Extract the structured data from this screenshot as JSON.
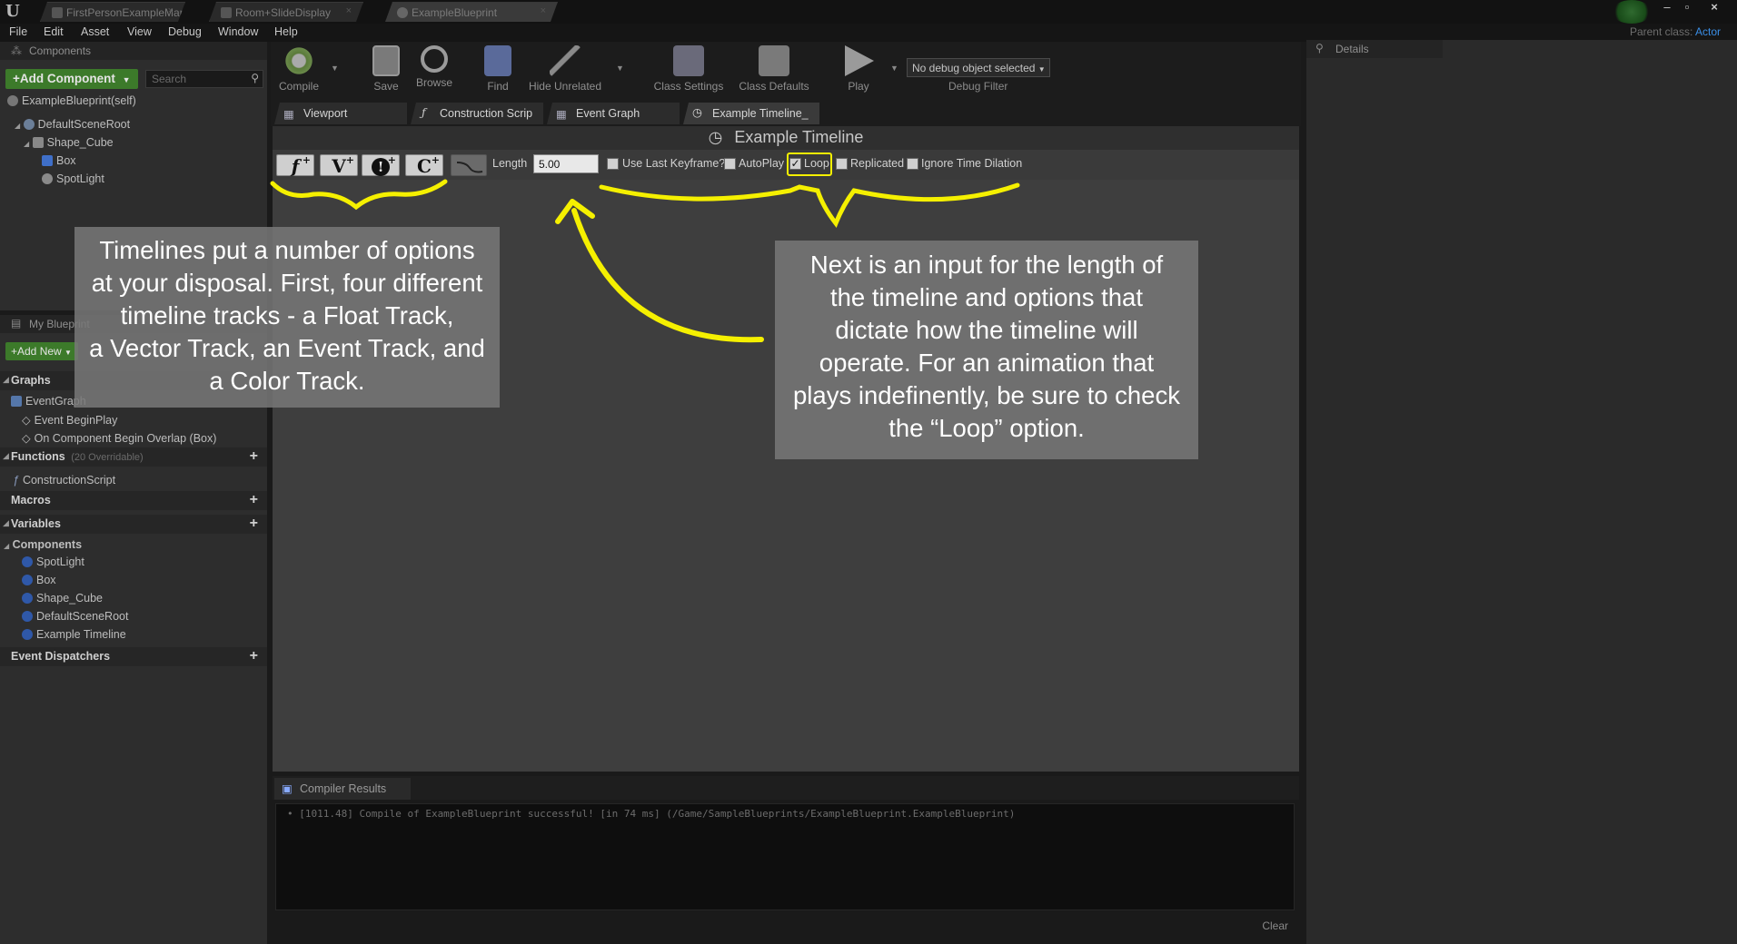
{
  "window": {
    "logo": "U",
    "tabs": [
      "FirstPersonExampleMap",
      "Room+SlideDisplay",
      "ExampleBlueprint"
    ],
    "parent_class_label": "Parent class:",
    "parent_class_value": "Actor"
  },
  "menu": [
    "File",
    "Edit",
    "Asset",
    "View",
    "Debug",
    "Window",
    "Help"
  ],
  "components_panel": {
    "title": "Components",
    "add_button": "+Add Component",
    "search_placeholder": "Search",
    "self_item": "ExampleBlueprint(self)",
    "tree": [
      "DefaultSceneRoot",
      "Shape_Cube",
      "Box",
      "SpotLight"
    ]
  },
  "my_blueprint": {
    "title": "My Blueprint",
    "add_new": "+Add New",
    "graphs_label": "Graphs",
    "event_graph": "EventGraph",
    "events": [
      "Event BeginPlay",
      "On Component Begin Overlap (Box)"
    ],
    "functions_label": "Functions",
    "functions_overridable": "(20 Overridable)",
    "construction_script": "ConstructionScript",
    "macros_label": "Macros",
    "variables_label": "Variables",
    "components_label": "Components",
    "components": [
      "SpotLight",
      "Box",
      "Shape_Cube",
      "DefaultSceneRoot",
      "Example Timeline"
    ],
    "event_dispatchers_label": "Event Dispatchers"
  },
  "toolbar": {
    "compile": "Compile",
    "save": "Save",
    "browse": "Browse",
    "find": "Find",
    "hide_unrelated": "Hide Unrelated",
    "class_settings": "Class Settings",
    "class_defaults": "Class Defaults",
    "play": "Play",
    "debug_select": "No debug object selected",
    "debug_filter": "Debug Filter"
  },
  "editor_tabs": [
    "Viewport",
    "Construction Scrip",
    "Event Graph",
    "Example Timeline_"
  ],
  "timeline": {
    "title": "Example Timeline",
    "track_buttons": [
      "f",
      "V",
      "!",
      "C"
    ],
    "length_label": "Length",
    "length_value": "5.00",
    "options": [
      {
        "label": "Use Last Keyframe?",
        "checked": false
      },
      {
        "label": "AutoPlay",
        "checked": false
      },
      {
        "label": "Loop",
        "checked": true
      },
      {
        "label": "Replicated",
        "checked": false
      },
      {
        "label": "Ignore Time Dilation",
        "checked": false
      }
    ]
  },
  "annotations": {
    "left_lines": [
      "Timelines put a number of options",
      "at your disposal. First, four different",
      "timeline tracks - a Float Track,",
      "a Vector Track, an Event Track, and",
      "a Color Track."
    ],
    "right_lines": [
      "Next is an input for the length of",
      "the timeline and options that",
      "dictate how the timeline will",
      "operate. For an animation that",
      "plays indefinently, be sure to check",
      "the “Loop” option."
    ]
  },
  "compiler": {
    "tab": "Compiler Results",
    "log": "• [1011.48] Compile of ExampleBlueprint successful! [in 74 ms] (/Game/SampleBlueprints/ExampleBlueprint.ExampleBlueprint)",
    "clear": "Clear"
  },
  "details": {
    "title": "Details"
  },
  "colors": {
    "accent_yellow": "#f5f000",
    "add_green": "#3c7a2a",
    "link_blue": "#3a8ee6"
  }
}
